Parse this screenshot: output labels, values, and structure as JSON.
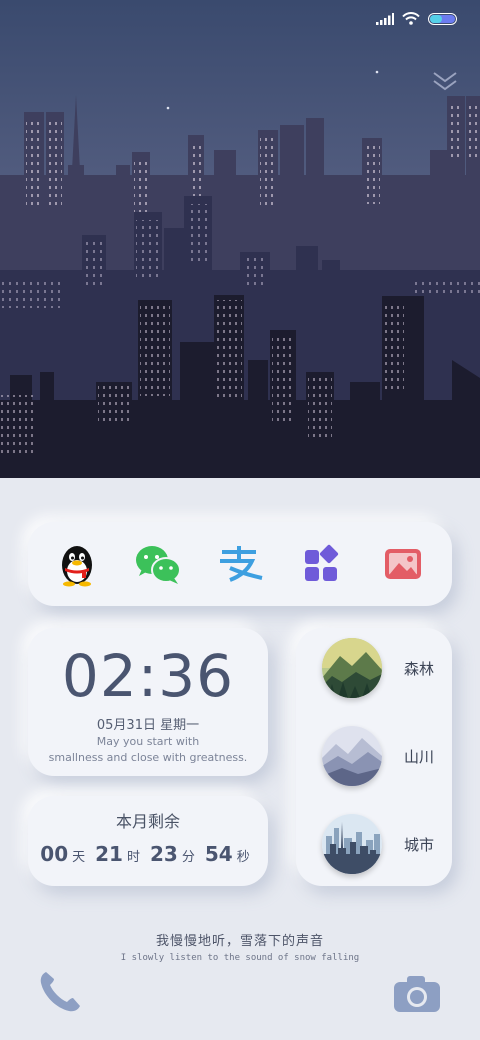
{
  "status_bar": {
    "battery_color": "#6c7cf0"
  },
  "dock": {
    "apps": [
      {
        "name": "qq-icon"
      },
      {
        "name": "wechat-icon"
      },
      {
        "name": "alipay-icon"
      },
      {
        "name": "apps-icon"
      },
      {
        "name": "gallery-icon"
      }
    ]
  },
  "clock": {
    "time": "02:36",
    "date": "05月31日  星期一",
    "motto_line1": "May you start with",
    "motto_line2": "smallness and close with greatness."
  },
  "countdown": {
    "title": "本月剩余",
    "days": "00",
    "days_unit": "天",
    "hours": "21",
    "hours_unit": "时",
    "minutes": "23",
    "minutes_unit": "分",
    "seconds": "54",
    "seconds_unit": "秒"
  },
  "scenes": [
    {
      "label": "森林"
    },
    {
      "label": "山川"
    },
    {
      "label": "城市"
    }
  ],
  "quote": {
    "cn": "我慢慢地听，雪落下的声音",
    "en": "I slowly listen to the sound of snow falling"
  },
  "colors": {
    "accent": "#4a5570",
    "panel": "#f2f4f9",
    "background": "#e6e9f0"
  }
}
